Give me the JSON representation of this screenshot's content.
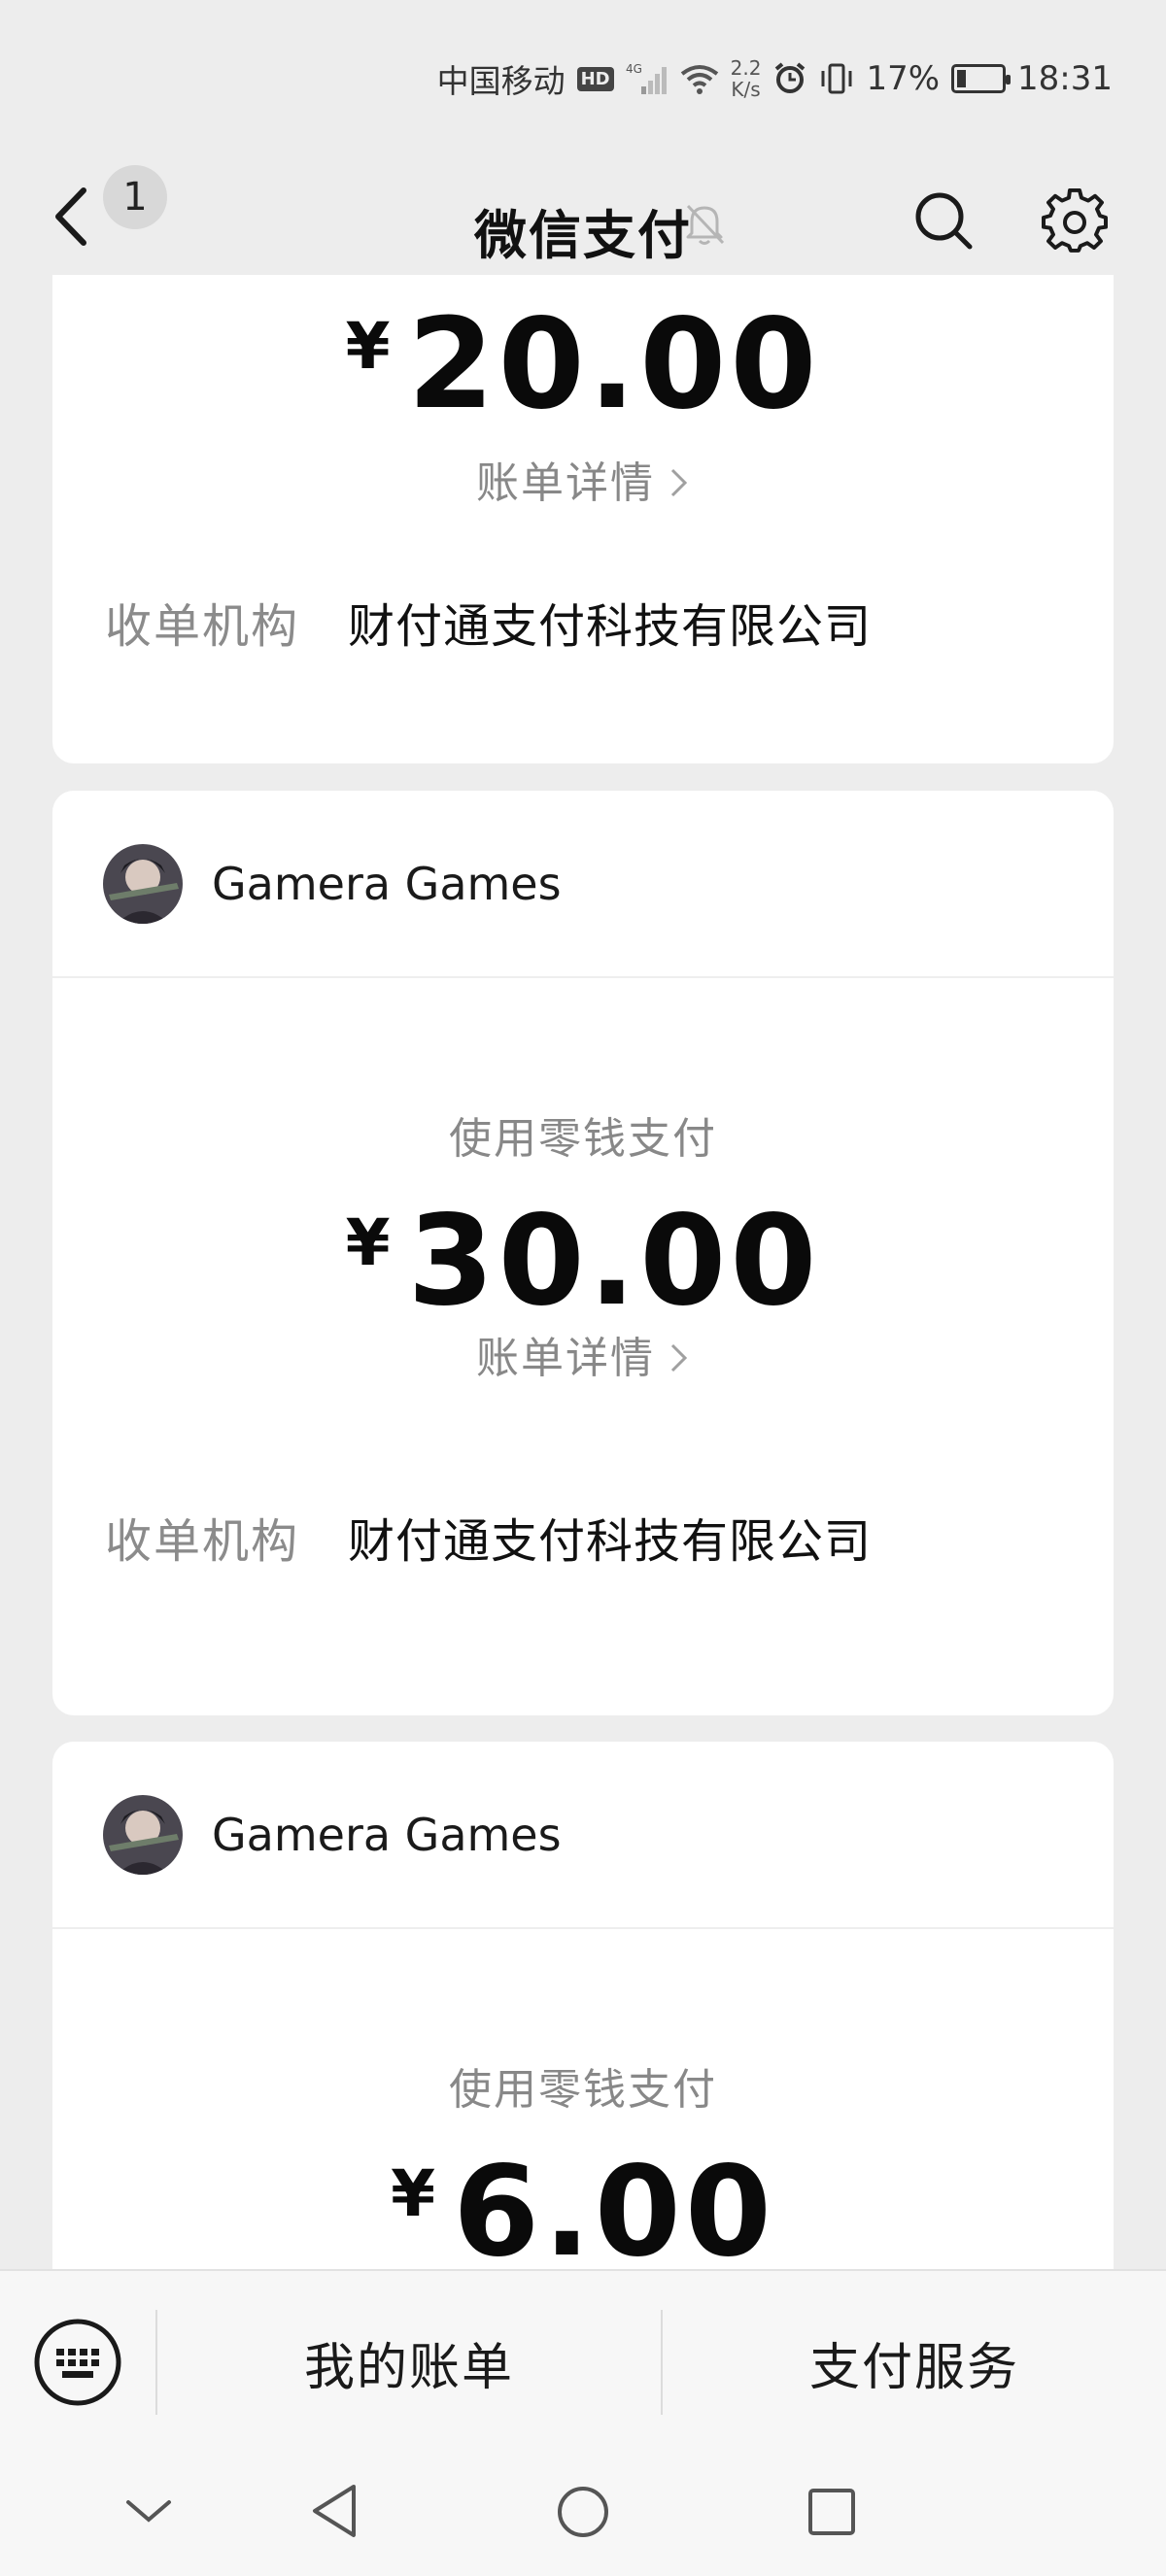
{
  "status_bar": {
    "carrier": "中国移动",
    "hd": "HD",
    "net_speed_value": "2.2",
    "net_speed_unit": "K/s",
    "battery": "17%",
    "time": "18:31"
  },
  "nav": {
    "unread_count": "1",
    "title": "微信支付"
  },
  "cards": [
    {
      "amount_currency": "¥",
      "amount": "20.00",
      "detail_link": "账单详情",
      "acquirer_label": "收单机构",
      "acquirer_value": "财付通支付科技有限公司"
    },
    {
      "merchant": "Gamera Games",
      "pay_method": "使用零钱支付",
      "amount_currency": "¥",
      "amount": "30.00",
      "detail_link": "账单详情",
      "acquirer_label": "收单机构",
      "acquirer_value": "财付通支付科技有限公司"
    },
    {
      "merchant": "Gamera Games",
      "pay_method": "使用零钱支付",
      "amount_currency": "¥",
      "amount": "6.00"
    }
  ],
  "bottom_menu": {
    "my_bills": "我的账单",
    "pay_services": "支付服务"
  },
  "icons": {
    "back": "back-arrow-icon",
    "mute": "bell-muted-icon",
    "search": "search-icon",
    "settings": "gear-icon",
    "keyboard": "keyboard-icon"
  }
}
